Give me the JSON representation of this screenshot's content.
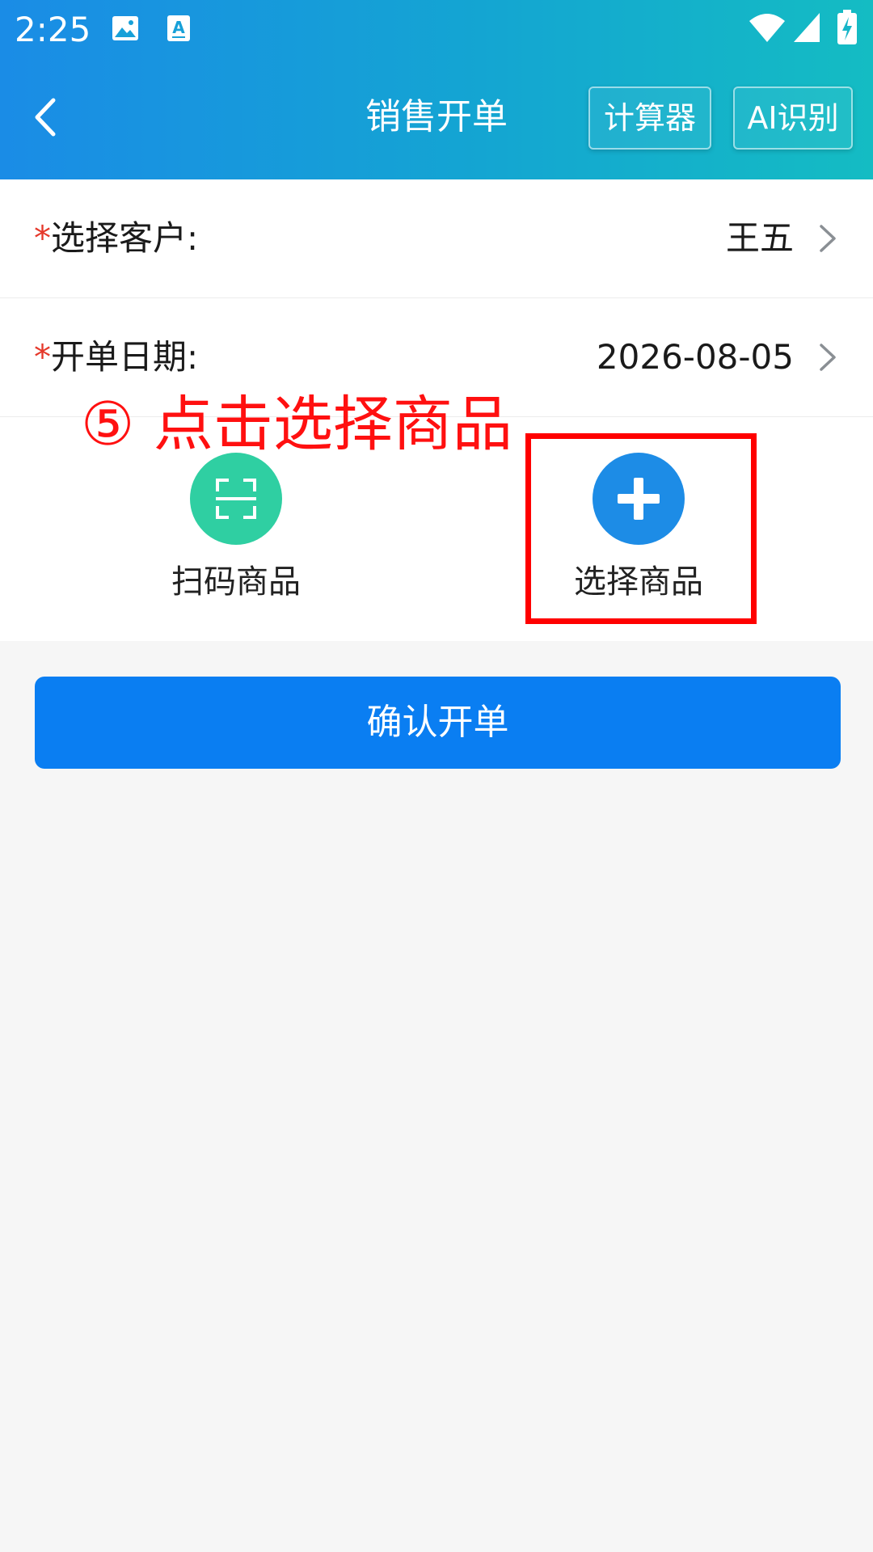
{
  "status_bar": {
    "time": "2:25",
    "icons": [
      "image-icon",
      "text-recognition-icon",
      "wifi-icon",
      "signal-icon",
      "battery-charging-icon"
    ]
  },
  "nav": {
    "back_icon": "chevron-left-icon",
    "title": "销售开单",
    "calculator_label": "计算器",
    "ai_label": "AI识别"
  },
  "form": {
    "customer": {
      "required_mark": "*",
      "label": "选择客户:",
      "value": "王五"
    },
    "date": {
      "required_mark": "*",
      "label": "开单日期:",
      "value": "2026-08-05"
    }
  },
  "actions": {
    "scan_label": "扫码商品",
    "select_label": "选择商品"
  },
  "annotation": {
    "text": "⑤ 点击选择商品"
  },
  "confirm_label": "确认开单",
  "colors": {
    "header_gradient_start": "#1a8ce6",
    "header_gradient_end": "#14bcc3",
    "primary": "#0a7ef2",
    "scan_green": "#2fcfa2",
    "required_red": "#e5392b",
    "annotation_red": "#ff0000"
  }
}
